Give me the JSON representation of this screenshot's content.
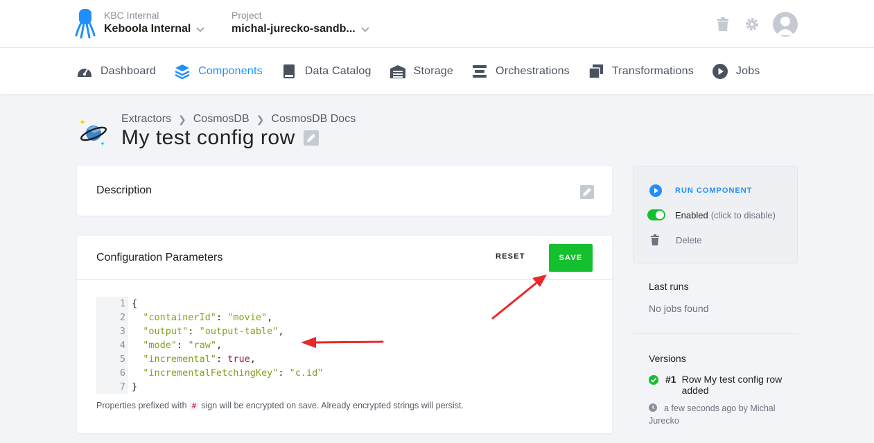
{
  "header": {
    "org_label": "KBC Internal",
    "org_name": "Keboola Internal",
    "project_label": "Project",
    "project_name": "michal-jurecko-sandb..."
  },
  "nav": [
    {
      "label": "Dashboard",
      "icon": "dashboard-icon"
    },
    {
      "label": "Components",
      "icon": "layers-icon",
      "active": true
    },
    {
      "label": "Data Catalog",
      "icon": "book-icon"
    },
    {
      "label": "Storage",
      "icon": "warehouse-icon"
    },
    {
      "label": "Orchestrations",
      "icon": "bars-icon"
    },
    {
      "label": "Transformations",
      "icon": "window-restore-icon"
    },
    {
      "label": "Jobs",
      "icon": "play-circle-icon"
    }
  ],
  "breadcrumb": [
    "Extractors",
    "CosmosDB",
    "CosmosDB Docs"
  ],
  "page_title": "My test config row",
  "description": {
    "title": "Description"
  },
  "config": {
    "title": "Configuration Parameters",
    "reset_label": "RESET",
    "save_label": "SAVE",
    "lines": [
      {
        "n": "1"
      },
      {
        "n": "2"
      },
      {
        "n": "3"
      },
      {
        "n": "4"
      },
      {
        "n": "5"
      },
      {
        "n": "6"
      },
      {
        "n": "7"
      }
    ],
    "code": {
      "open": "{",
      "close": "}",
      "containerId_key": "\"containerId\"",
      "containerId_val": "\"movie\"",
      "output_key": "\"output\"",
      "output_val": "\"output-table\"",
      "mode_key": "\"mode\"",
      "mode_val": "\"raw\"",
      "incremental_key": "\"incremental\"",
      "incremental_val": "true",
      "fetching_key": "\"incrementalFetchingKey\"",
      "fetching_val": "\"c.id\""
    },
    "hint_before": "Properties prefixed with",
    "hint_hash": "#",
    "hint_after": "sign will be encrypted on save. Already encrypted strings will persist."
  },
  "sidebar": {
    "run_label": "RUN COMPONENT",
    "enabled_label": "Enabled",
    "enabled_hint": "(click to disable)",
    "delete_label": "Delete",
    "last_runs_title": "Last runs",
    "last_runs_empty": "No jobs found",
    "versions_title": "Versions",
    "version_number": "#1",
    "version_text": "Row My test config row added",
    "version_meta": "a few seconds ago by Michal Jurecko"
  },
  "colors": {
    "accent": "#1f8fff",
    "save_green": "#14c02e",
    "arrow_red": "#e8282b"
  }
}
